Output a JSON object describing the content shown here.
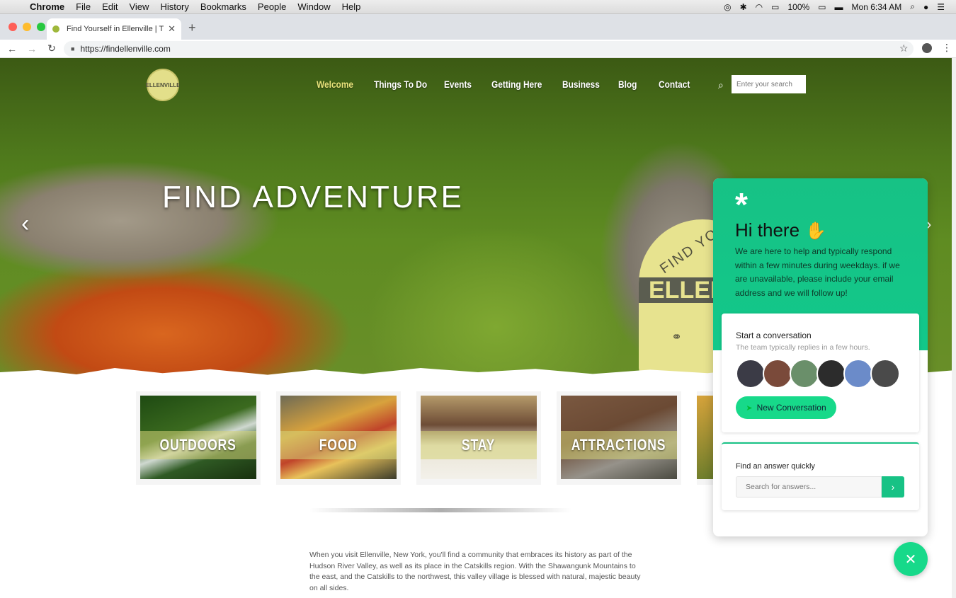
{
  "os_menubar": {
    "app": "Chrome",
    "menus": [
      "File",
      "Edit",
      "View",
      "History",
      "Bookmarks",
      "People",
      "Window",
      "Help"
    ],
    "battery": "100%",
    "clock": "Mon 6:34 AM"
  },
  "browser": {
    "tab_title": "Find Yourself in Ellenville | Trav",
    "url": "https://findellenville.com"
  },
  "site": {
    "logo_text": "ELLENVILLE",
    "nav": [
      "Welcome",
      "Things To Do",
      "Events",
      "Getting Here",
      "Business",
      "Blog",
      "Contact"
    ],
    "search_placeholder": "Enter your search",
    "hero_title": "FIND ADVENTURE",
    "badge_top": "FIND YO",
    "badge_band": "ELLEN",
    "tiles": [
      "OUTDOORS",
      "FOOD",
      "STAY",
      "ATTRACTIONS"
    ],
    "intro_text": "When you visit Ellenville, New York, you'll find a community that embraces its history as part of the Hudson River Valley, as well as its place in the Catskills region. With the Shawangunk Mountains to the east, and the Catskills to the northwest, this valley village is blessed with natural, majestic beauty on all sides."
  },
  "chat": {
    "greeting": "Hi there",
    "message": "We are here to help and typically respond within a few minutes during weekdays. if we are unavailable, please include your email address and we will follow up!",
    "start_title": "Start a conversation",
    "start_sub": "The team typically replies in a few hours.",
    "avatar_colors": [
      "#3b3b46",
      "#7a4a3a",
      "#6a8f6a",
      "#2c2c2c",
      "#6b8bc9",
      "#4a4a4a"
    ],
    "new_conversation": "New Conversation",
    "find_title": "Find an answer quickly",
    "search_placeholder": "Search for answers..."
  },
  "colors": {
    "accent": "#17c285",
    "nav_active": "#e8e37a"
  }
}
